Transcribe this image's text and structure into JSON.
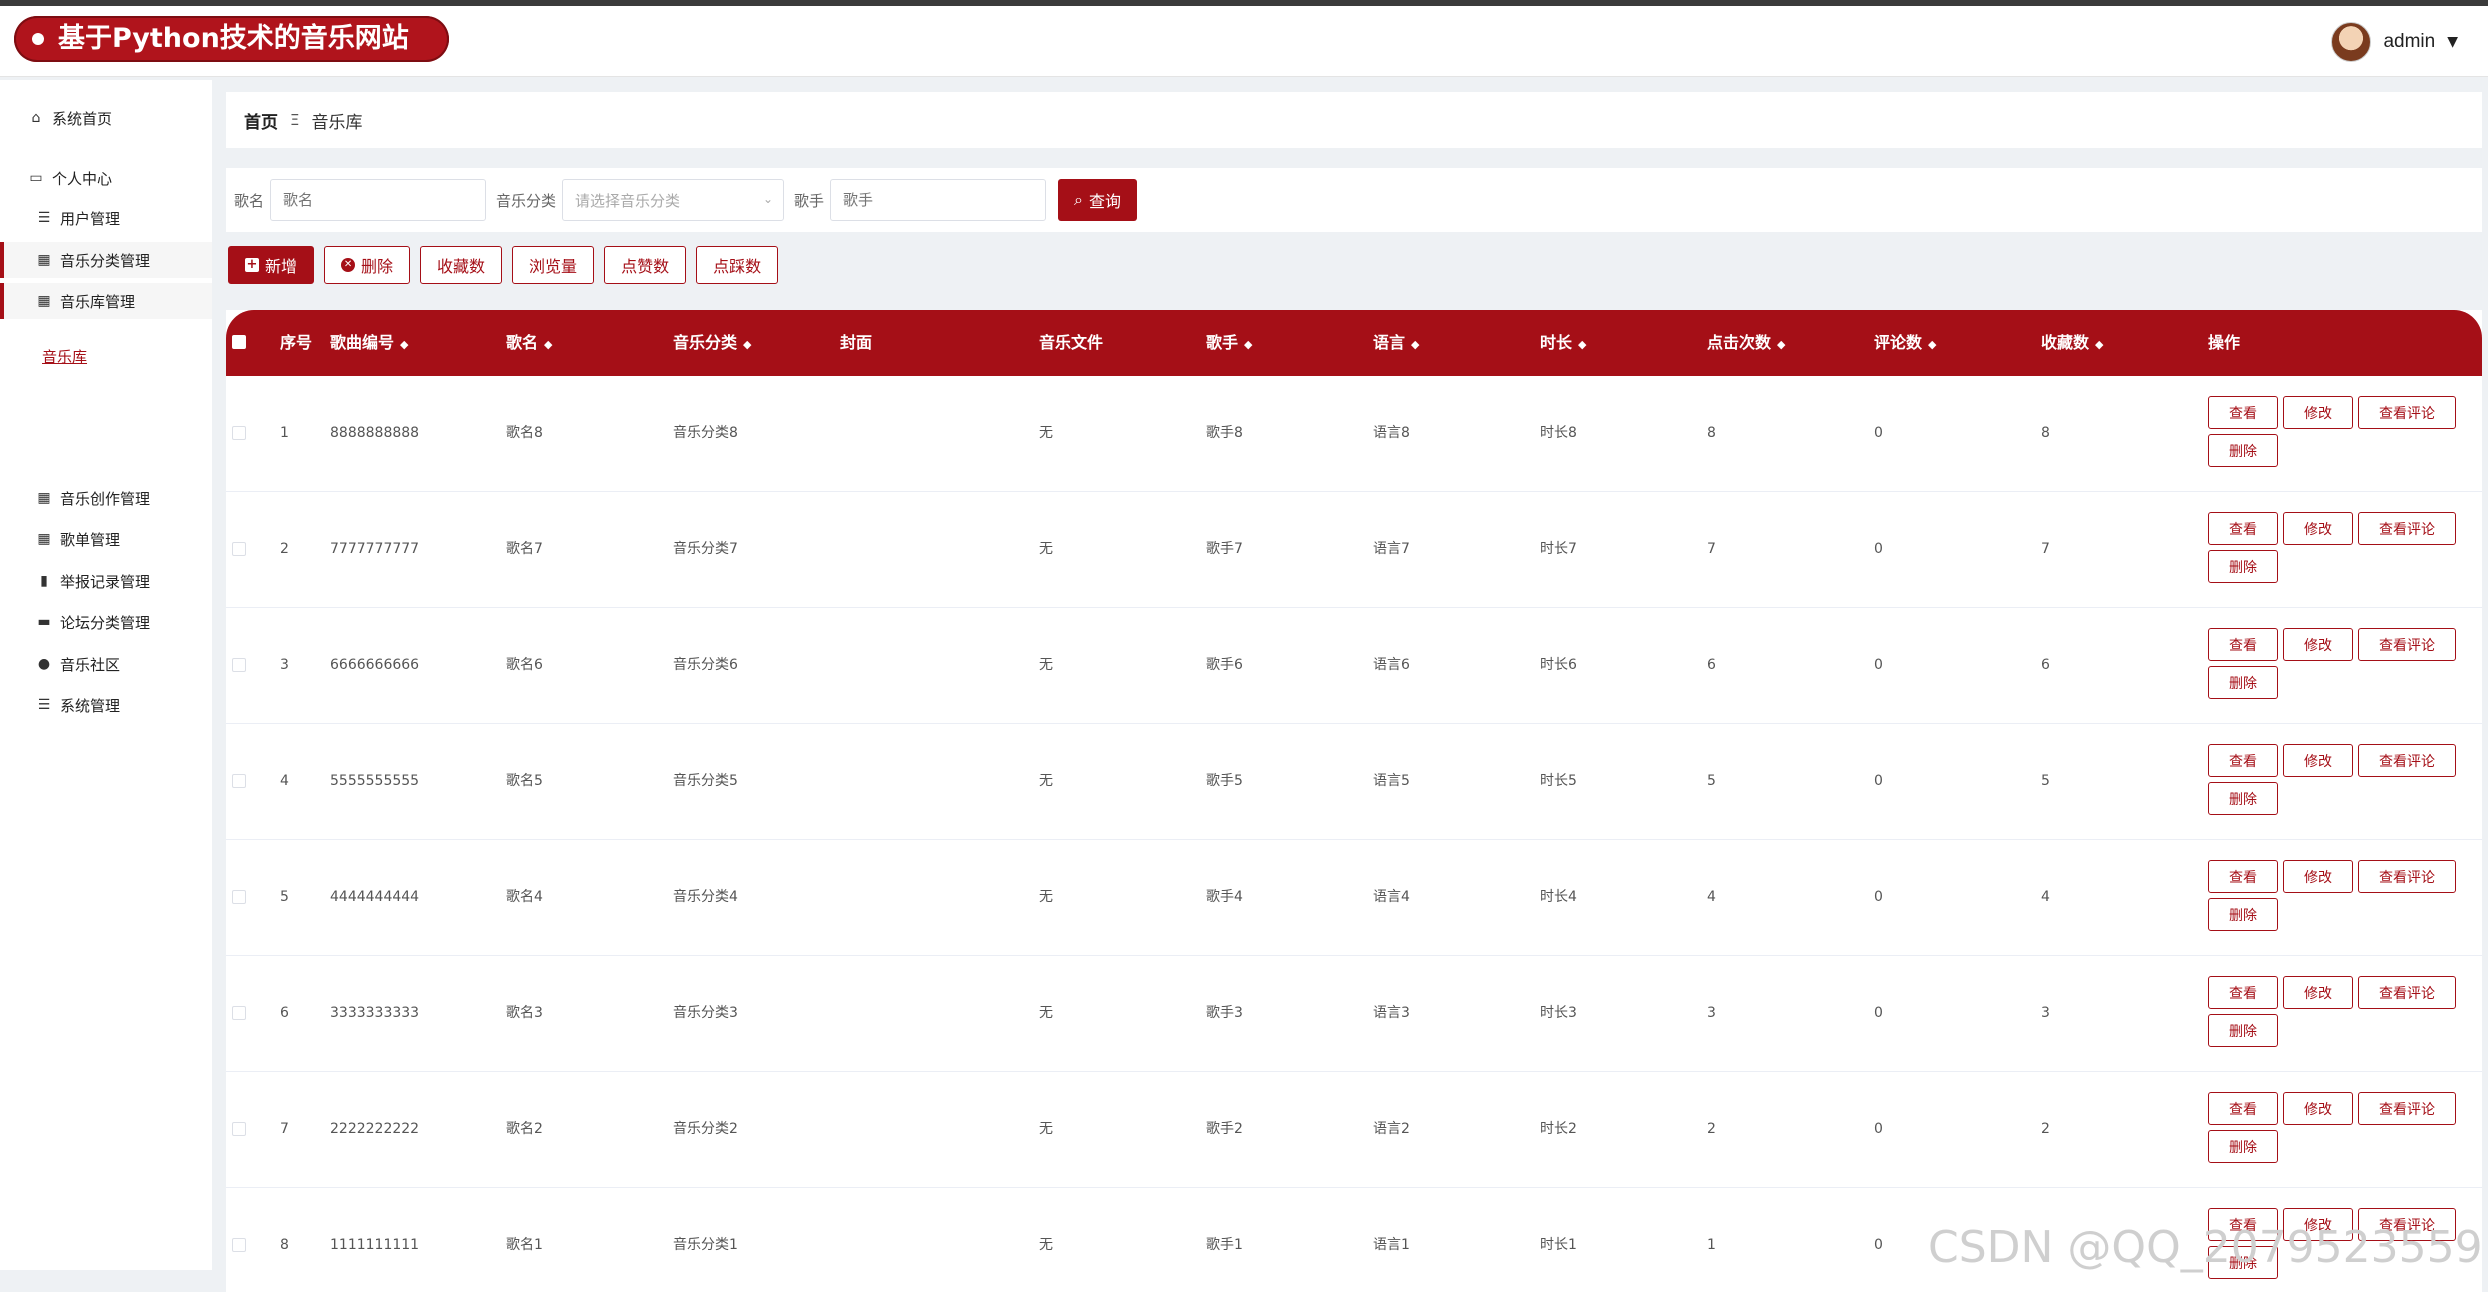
{
  "app": {
    "title": "基于Python技术的音乐网站"
  },
  "user": {
    "name": "admin"
  },
  "sidebar": {
    "home": "系统首页",
    "personal": "个人中心",
    "items": [
      {
        "label": "用户管理",
        "icon": "list-icon"
      },
      {
        "label": "音乐分类管理",
        "icon": "grid-icon"
      },
      {
        "label": "音乐库管理",
        "icon": "grid-icon"
      },
      {
        "label": "音乐创作管理",
        "icon": "grid-icon"
      },
      {
        "label": "歌单管理",
        "icon": "grid-icon"
      },
      {
        "label": "举报记录管理",
        "icon": "bar-chart-icon"
      },
      {
        "label": "论坛分类管理",
        "icon": "briefcase-icon"
      },
      {
        "label": "音乐社区",
        "icon": "person-icon"
      },
      {
        "label": "系统管理",
        "icon": "list-icon"
      }
    ],
    "active_sub": "音乐库"
  },
  "breadcrumb": {
    "home": "首页",
    "sep": "Ξ",
    "current": "音乐库"
  },
  "search": {
    "song_label": "歌名",
    "song_placeholder": "歌名",
    "category_label": "音乐分类",
    "category_placeholder": "请选择音乐分类",
    "singer_label": "歌手",
    "singer_placeholder": "歌手",
    "query_label": "查询"
  },
  "toolbar": {
    "add": "新增",
    "delete": "删除",
    "fav": "收藏数",
    "views": "浏览量",
    "likes": "点赞数",
    "dislikes": "点踩数"
  },
  "table": {
    "headers": {
      "index": "序号",
      "code": "歌曲编号",
      "name": "歌名",
      "category": "音乐分类",
      "cover": "封面",
      "file": "音乐文件",
      "singer": "歌手",
      "language": "语言",
      "duration": "时长",
      "clicks": "点击次数",
      "comments": "评论数",
      "favorites": "收藏数",
      "ops": "操作"
    },
    "ops": {
      "view": "查看",
      "edit": "修改",
      "view_comments": "查看评论",
      "delete": "删除"
    },
    "rows": [
      {
        "index": "1",
        "code": "8888888888",
        "name": "歌名8",
        "category": "音乐分类8",
        "file": "无",
        "singer": "歌手8",
        "language": "语言8",
        "duration": "时长8",
        "clicks": "8",
        "comments": "0",
        "favorites": "8"
      },
      {
        "index": "2",
        "code": "7777777777",
        "name": "歌名7",
        "category": "音乐分类7",
        "file": "无",
        "singer": "歌手7",
        "language": "语言7",
        "duration": "时长7",
        "clicks": "7",
        "comments": "0",
        "favorites": "7"
      },
      {
        "index": "3",
        "code": "6666666666",
        "name": "歌名6",
        "category": "音乐分类6",
        "file": "无",
        "singer": "歌手6",
        "language": "语言6",
        "duration": "时长6",
        "clicks": "6",
        "comments": "0",
        "favorites": "6"
      },
      {
        "index": "4",
        "code": "5555555555",
        "name": "歌名5",
        "category": "音乐分类5",
        "file": "无",
        "singer": "歌手5",
        "language": "语言5",
        "duration": "时长5",
        "clicks": "5",
        "comments": "0",
        "favorites": "5"
      },
      {
        "index": "5",
        "code": "4444444444",
        "name": "歌名4",
        "category": "音乐分类4",
        "file": "无",
        "singer": "歌手4",
        "language": "语言4",
        "duration": "时长4",
        "clicks": "4",
        "comments": "0",
        "favorites": "4"
      },
      {
        "index": "6",
        "code": "3333333333",
        "name": "歌名3",
        "category": "音乐分类3",
        "file": "无",
        "singer": "歌手3",
        "language": "语言3",
        "duration": "时长3",
        "clicks": "3",
        "comments": "0",
        "favorites": "3"
      },
      {
        "index": "7",
        "code": "2222222222",
        "name": "歌名2",
        "category": "音乐分类2",
        "file": "无",
        "singer": "歌手2",
        "language": "语言2",
        "duration": "时长2",
        "clicks": "2",
        "comments": "0",
        "favorites": "2"
      },
      {
        "index": "8",
        "code": "1111111111",
        "name": "歌名1",
        "category": "音乐分类1",
        "file": "无",
        "singer": "歌手1",
        "language": "语言1",
        "duration": "时长1",
        "clicks": "1",
        "comments": "0",
        "favorites": ""
      }
    ]
  },
  "watermark": "CSDN @QQ_2079523559",
  "colors": {
    "accent": "#a50f17"
  }
}
